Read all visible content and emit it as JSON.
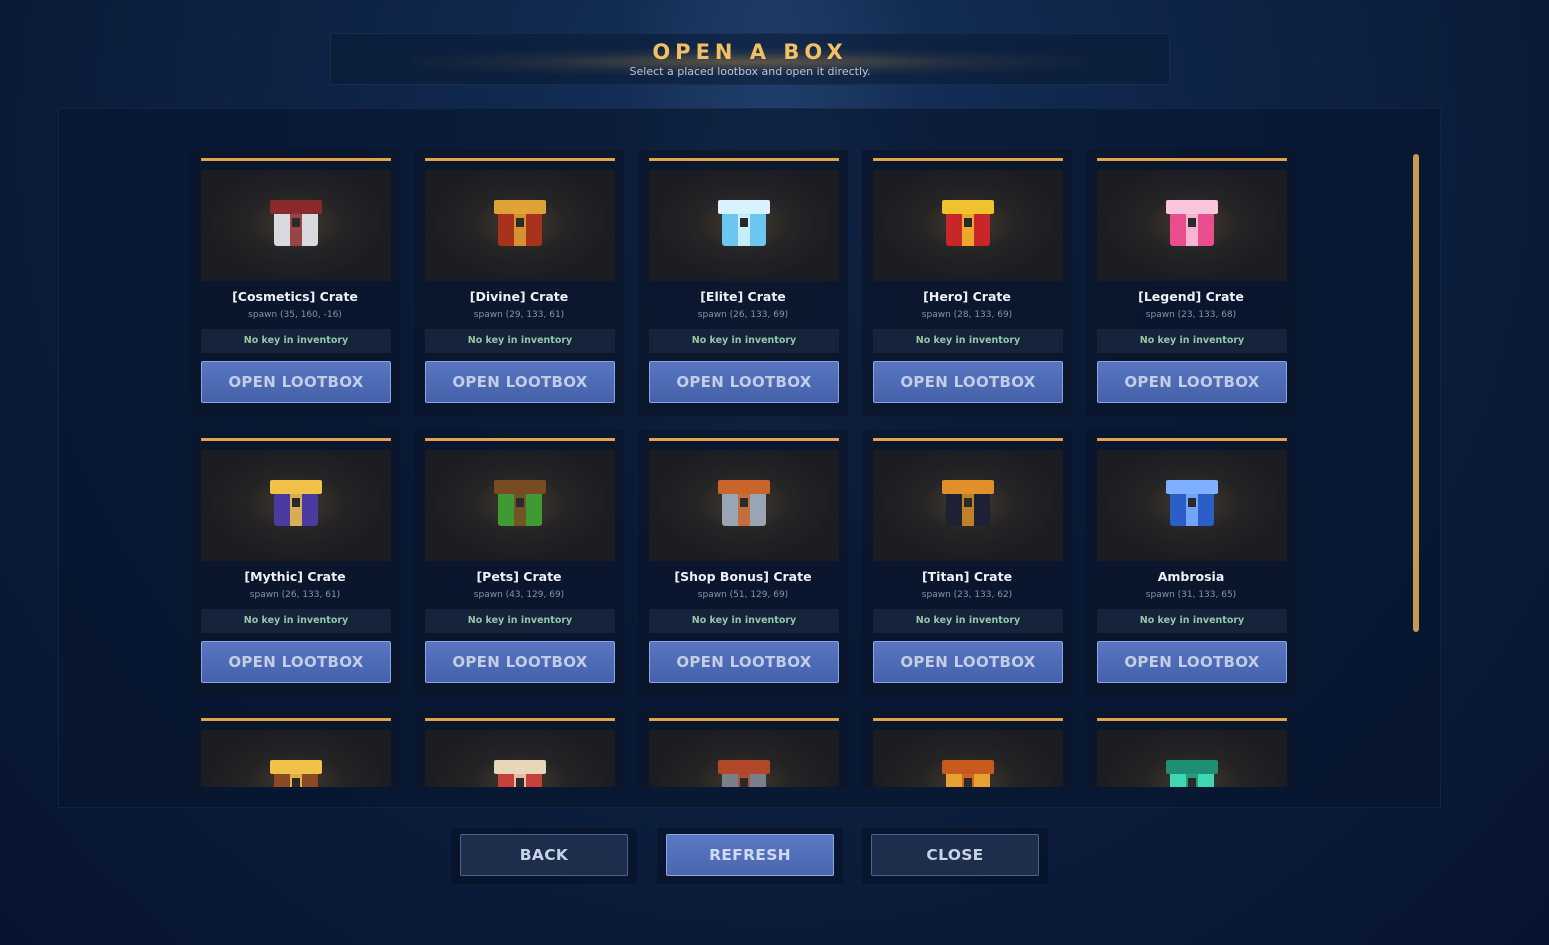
{
  "header": {
    "title": "OPEN A BOX",
    "subtitle": "Select a placed lootbox and open it directly."
  },
  "crates": [
    {
      "name": "[Cosmetics] Crate",
      "spawn": "spawn (35, 160, -16)",
      "key_status": "No key in inventory",
      "button": "OPEN LOOTBOX",
      "icon": "cosmetics-crate-icon",
      "colors": [
        "#d9d9e0",
        "#8b2a2a"
      ]
    },
    {
      "name": "[Divine] Crate",
      "spawn": "spawn (29, 133, 61)",
      "key_status": "No key in inventory",
      "button": "OPEN LOOTBOX",
      "icon": "divine-crate-icon",
      "colors": [
        "#a8321c",
        "#e0a236"
      ]
    },
    {
      "name": "[Elite] Crate",
      "spawn": "spawn (26, 133, 69)",
      "key_status": "No key in inventory",
      "button": "OPEN LOOTBOX",
      "icon": "elite-crate-icon",
      "colors": [
        "#6cc7f0",
        "#d8f3ff"
      ]
    },
    {
      "name": "[Hero] Crate",
      "spawn": "spawn (28, 133, 69)",
      "key_status": "No key in inventory",
      "button": "OPEN LOOTBOX",
      "icon": "hero-crate-icon",
      "colors": [
        "#c8262a",
        "#f2c12e"
      ]
    },
    {
      "name": "[Legend] Crate",
      "spawn": "spawn (23, 133, 68)",
      "key_status": "No key in inventory",
      "button": "OPEN LOOTBOX",
      "icon": "legend-crate-icon",
      "colors": [
        "#e94f8f",
        "#f7c6da"
      ]
    },
    {
      "name": "[Mythic] Crate",
      "spawn": "spawn (26, 133, 61)",
      "key_status": "No key in inventory",
      "button": "OPEN LOOTBOX",
      "icon": "mythic-crate-icon",
      "colors": [
        "#4b3aa0",
        "#f0c24a"
      ]
    },
    {
      "name": "[Pets] Crate",
      "spawn": "spawn (43, 129, 69)",
      "key_status": "No key in inventory",
      "button": "OPEN LOOTBOX",
      "icon": "pets-crate-icon",
      "colors": [
        "#3f9a36",
        "#7a4a22"
      ]
    },
    {
      "name": "[Shop Bonus] Crate",
      "spawn": "spawn (51, 129, 69)",
      "key_status": "No key in inventory",
      "button": "OPEN LOOTBOX",
      "icon": "shop-bonus-crate-icon",
      "colors": [
        "#9aa5b4",
        "#c9642a"
      ]
    },
    {
      "name": "[Titan] Crate",
      "spawn": "spawn (23, 133, 62)",
      "key_status": "No key in inventory",
      "button": "OPEN LOOTBOX",
      "icon": "titan-crate-icon",
      "colors": [
        "#1c2233",
        "#e0902a"
      ]
    },
    {
      "name": "Ambrosia",
      "spawn": "spawn (31, 133, 65)",
      "key_status": "No key in inventory",
      "button": "OPEN LOOTBOX",
      "icon": "ambrosia-crate-icon",
      "colors": [
        "#2b5fc7",
        "#7fb0ff"
      ]
    },
    {
      "icon": "crate-icon-11",
      "colors": [
        "#8a4a22",
        "#f0c24a"
      ]
    },
    {
      "icon": "crate-icon-12",
      "colors": [
        "#c8403a",
        "#e6d6b8"
      ]
    },
    {
      "icon": "crate-icon-13",
      "colors": [
        "#7a7f8a",
        "#b3472a"
      ]
    },
    {
      "icon": "crate-icon-14",
      "colors": [
        "#e8a030",
        "#c85a1e"
      ]
    },
    {
      "icon": "crate-icon-15",
      "colors": [
        "#3fd6b2",
        "#1f8f74"
      ]
    }
  ],
  "footer": {
    "back_label": "BACK",
    "refresh_label": "REFRESH",
    "close_label": "CLOSE"
  },
  "theme": {
    "accent": "#e3a34a",
    "button_blue": "#4a66ae",
    "key_text": "#8fc9a8"
  }
}
